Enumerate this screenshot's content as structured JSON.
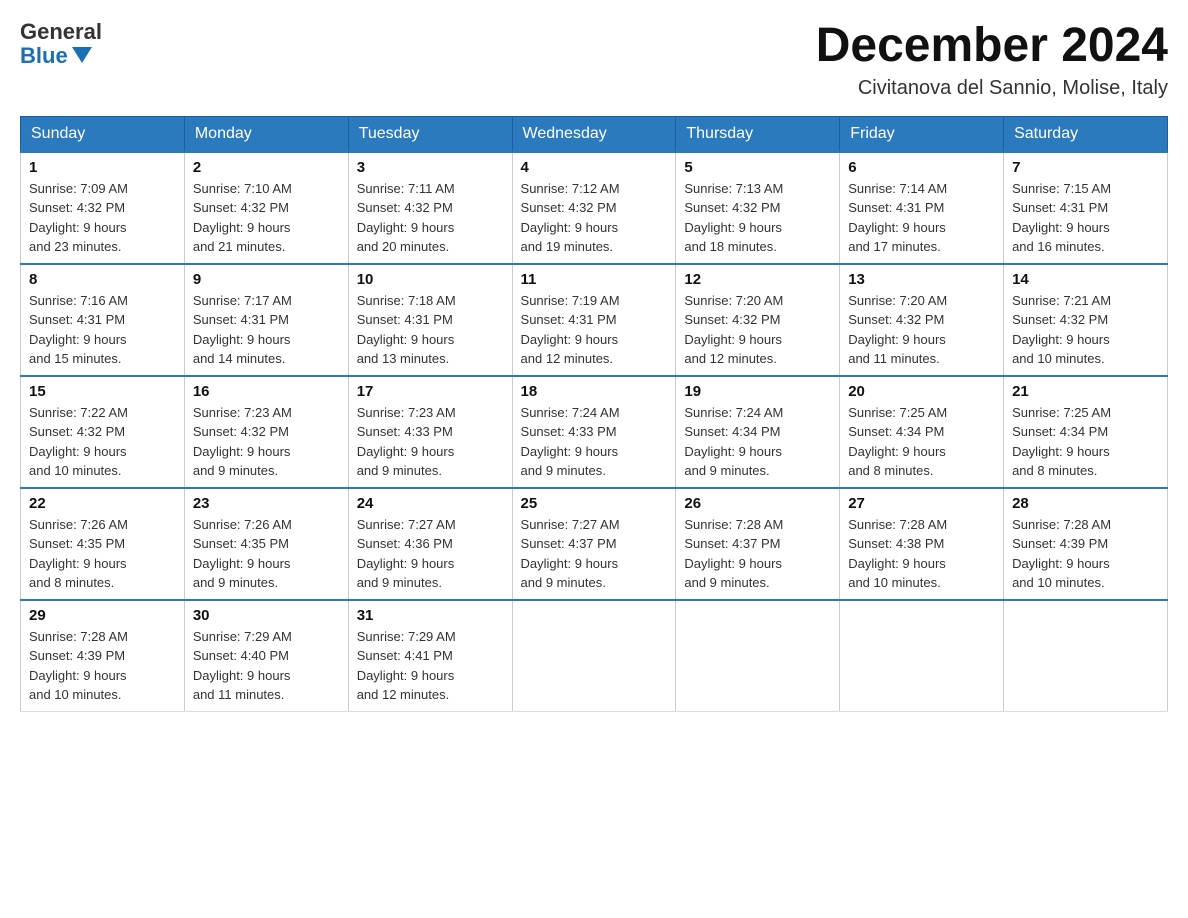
{
  "header": {
    "logo_general": "General",
    "logo_blue": "Blue",
    "month_title": "December 2024",
    "location": "Civitanova del Sannio, Molise, Italy"
  },
  "days_of_week": [
    "Sunday",
    "Monday",
    "Tuesday",
    "Wednesday",
    "Thursday",
    "Friday",
    "Saturday"
  ],
  "weeks": [
    [
      {
        "day": "1",
        "sunrise": "7:09 AM",
        "sunset": "4:32 PM",
        "daylight": "9 hours and 23 minutes."
      },
      {
        "day": "2",
        "sunrise": "7:10 AM",
        "sunset": "4:32 PM",
        "daylight": "9 hours and 21 minutes."
      },
      {
        "day": "3",
        "sunrise": "7:11 AM",
        "sunset": "4:32 PM",
        "daylight": "9 hours and 20 minutes."
      },
      {
        "day": "4",
        "sunrise": "7:12 AM",
        "sunset": "4:32 PM",
        "daylight": "9 hours and 19 minutes."
      },
      {
        "day": "5",
        "sunrise": "7:13 AM",
        "sunset": "4:32 PM",
        "daylight": "9 hours and 18 minutes."
      },
      {
        "day": "6",
        "sunrise": "7:14 AM",
        "sunset": "4:31 PM",
        "daylight": "9 hours and 17 minutes."
      },
      {
        "day": "7",
        "sunrise": "7:15 AM",
        "sunset": "4:31 PM",
        "daylight": "9 hours and 16 minutes."
      }
    ],
    [
      {
        "day": "8",
        "sunrise": "7:16 AM",
        "sunset": "4:31 PM",
        "daylight": "9 hours and 15 minutes."
      },
      {
        "day": "9",
        "sunrise": "7:17 AM",
        "sunset": "4:31 PM",
        "daylight": "9 hours and 14 minutes."
      },
      {
        "day": "10",
        "sunrise": "7:18 AM",
        "sunset": "4:31 PM",
        "daylight": "9 hours and 13 minutes."
      },
      {
        "day": "11",
        "sunrise": "7:19 AM",
        "sunset": "4:31 PM",
        "daylight": "9 hours and 12 minutes."
      },
      {
        "day": "12",
        "sunrise": "7:20 AM",
        "sunset": "4:32 PM",
        "daylight": "9 hours and 12 minutes."
      },
      {
        "day": "13",
        "sunrise": "7:20 AM",
        "sunset": "4:32 PM",
        "daylight": "9 hours and 11 minutes."
      },
      {
        "day": "14",
        "sunrise": "7:21 AM",
        "sunset": "4:32 PM",
        "daylight": "9 hours and 10 minutes."
      }
    ],
    [
      {
        "day": "15",
        "sunrise": "7:22 AM",
        "sunset": "4:32 PM",
        "daylight": "9 hours and 10 minutes."
      },
      {
        "day": "16",
        "sunrise": "7:23 AM",
        "sunset": "4:32 PM",
        "daylight": "9 hours and 9 minutes."
      },
      {
        "day": "17",
        "sunrise": "7:23 AM",
        "sunset": "4:33 PM",
        "daylight": "9 hours and 9 minutes."
      },
      {
        "day": "18",
        "sunrise": "7:24 AM",
        "sunset": "4:33 PM",
        "daylight": "9 hours and 9 minutes."
      },
      {
        "day": "19",
        "sunrise": "7:24 AM",
        "sunset": "4:34 PM",
        "daylight": "9 hours and 9 minutes."
      },
      {
        "day": "20",
        "sunrise": "7:25 AM",
        "sunset": "4:34 PM",
        "daylight": "9 hours and 8 minutes."
      },
      {
        "day": "21",
        "sunrise": "7:25 AM",
        "sunset": "4:34 PM",
        "daylight": "9 hours and 8 minutes."
      }
    ],
    [
      {
        "day": "22",
        "sunrise": "7:26 AM",
        "sunset": "4:35 PM",
        "daylight": "9 hours and 8 minutes."
      },
      {
        "day": "23",
        "sunrise": "7:26 AM",
        "sunset": "4:35 PM",
        "daylight": "9 hours and 9 minutes."
      },
      {
        "day": "24",
        "sunrise": "7:27 AM",
        "sunset": "4:36 PM",
        "daylight": "9 hours and 9 minutes."
      },
      {
        "day": "25",
        "sunrise": "7:27 AM",
        "sunset": "4:37 PM",
        "daylight": "9 hours and 9 minutes."
      },
      {
        "day": "26",
        "sunrise": "7:28 AM",
        "sunset": "4:37 PM",
        "daylight": "9 hours and 9 minutes."
      },
      {
        "day": "27",
        "sunrise": "7:28 AM",
        "sunset": "4:38 PM",
        "daylight": "9 hours and 10 minutes."
      },
      {
        "day": "28",
        "sunrise": "7:28 AM",
        "sunset": "4:39 PM",
        "daylight": "9 hours and 10 minutes."
      }
    ],
    [
      {
        "day": "29",
        "sunrise": "7:28 AM",
        "sunset": "4:39 PM",
        "daylight": "9 hours and 10 minutes."
      },
      {
        "day": "30",
        "sunrise": "7:29 AM",
        "sunset": "4:40 PM",
        "daylight": "9 hours and 11 minutes."
      },
      {
        "day": "31",
        "sunrise": "7:29 AM",
        "sunset": "4:41 PM",
        "daylight": "9 hours and 12 minutes."
      },
      null,
      null,
      null,
      null
    ]
  ],
  "labels": {
    "sunrise": "Sunrise:",
    "sunset": "Sunset:",
    "daylight": "Daylight:"
  }
}
